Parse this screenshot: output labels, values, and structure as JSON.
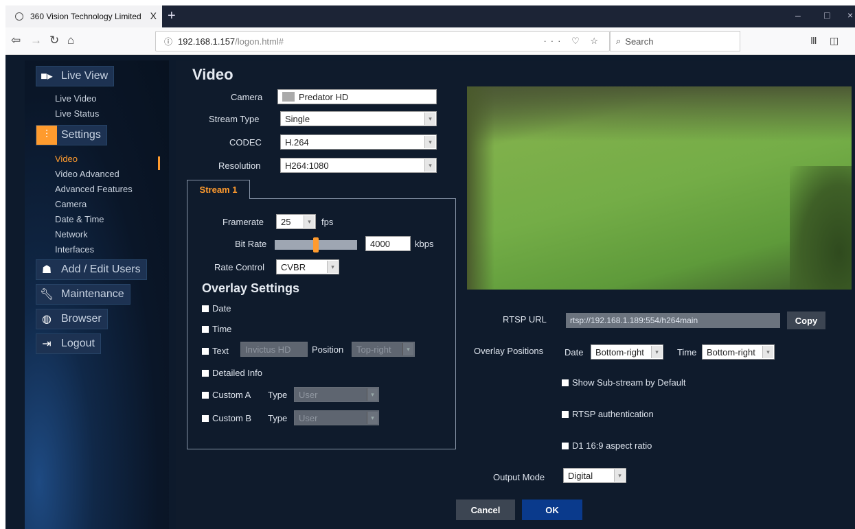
{
  "browser": {
    "tab_title": "360 Vision Technology Limited",
    "tab_close": "X",
    "new_tab": "+",
    "url_host": "192.168.1.157",
    "url_path": "/logon.html#",
    "url_actions": "··· ♡ ☆",
    "search_placeholder": "Search",
    "win_min": "–",
    "win_max": "□",
    "win_close": "×"
  },
  "sidebar": {
    "live_view": "Live View",
    "live_video": "Live Video",
    "live_status": "Live Status",
    "settings": "Settings",
    "video": "Video",
    "video_advanced": "Video Advanced",
    "advanced_features": "Advanced Features",
    "camera": "Camera",
    "date_time": "Date & Time",
    "network": "Network",
    "interfaces": "Interfaces",
    "add_edit_users": "Add / Edit Users",
    "maintenance": "Maintenance",
    "browser": "Browser",
    "logout": "Logout"
  },
  "video": {
    "title": "Video",
    "camera_label": "Camera",
    "camera_value": "Predator HD",
    "stream_type_label": "Stream Type",
    "stream_type_value": "Single",
    "codec_label": "CODEC",
    "codec_value": "H.264",
    "resolution_label": "Resolution",
    "resolution_value": "H264:1080",
    "stream_tab": "Stream 1",
    "framerate_label": "Framerate",
    "framerate_value": "25",
    "framerate_unit": "fps",
    "bitrate_label": "Bit Rate",
    "bitrate_value": "4000",
    "bitrate_unit": "kbps",
    "bitrate_slider_fraction": 0.5,
    "rate_control_label": "Rate Control",
    "rate_control_value": "CVBR",
    "overlay_title": "Overlay Settings",
    "ov_date": "Date",
    "ov_time": "Time",
    "ov_text": "Text",
    "ov_text_value": "Invictus HD",
    "ov_position_label": "Position",
    "ov_position_value": "Top-right",
    "ov_detailed": "Detailed Info",
    "ov_custom_a": "Custom A",
    "ov_custom_b": "Custom B",
    "type_label": "Type",
    "type_value": "User",
    "rtsp_label": "RTSP URL",
    "rtsp_value": "rtsp://192.168.1.189:554/h264main",
    "copy": "Copy",
    "overlay_positions_label": "Overlay Positions",
    "op_date_label": "Date",
    "op_date_value": "Bottom-right",
    "op_time_label": "Time",
    "op_time_value": "Bottom-right",
    "show_substream": "Show Sub-stream by Default",
    "rtsp_auth": "RTSP authentication",
    "d1_aspect": "D1 16:9 aspect ratio",
    "output_mode_label": "Output Mode",
    "output_mode_value": "Digital",
    "cancel": "Cancel",
    "ok": "OK"
  }
}
